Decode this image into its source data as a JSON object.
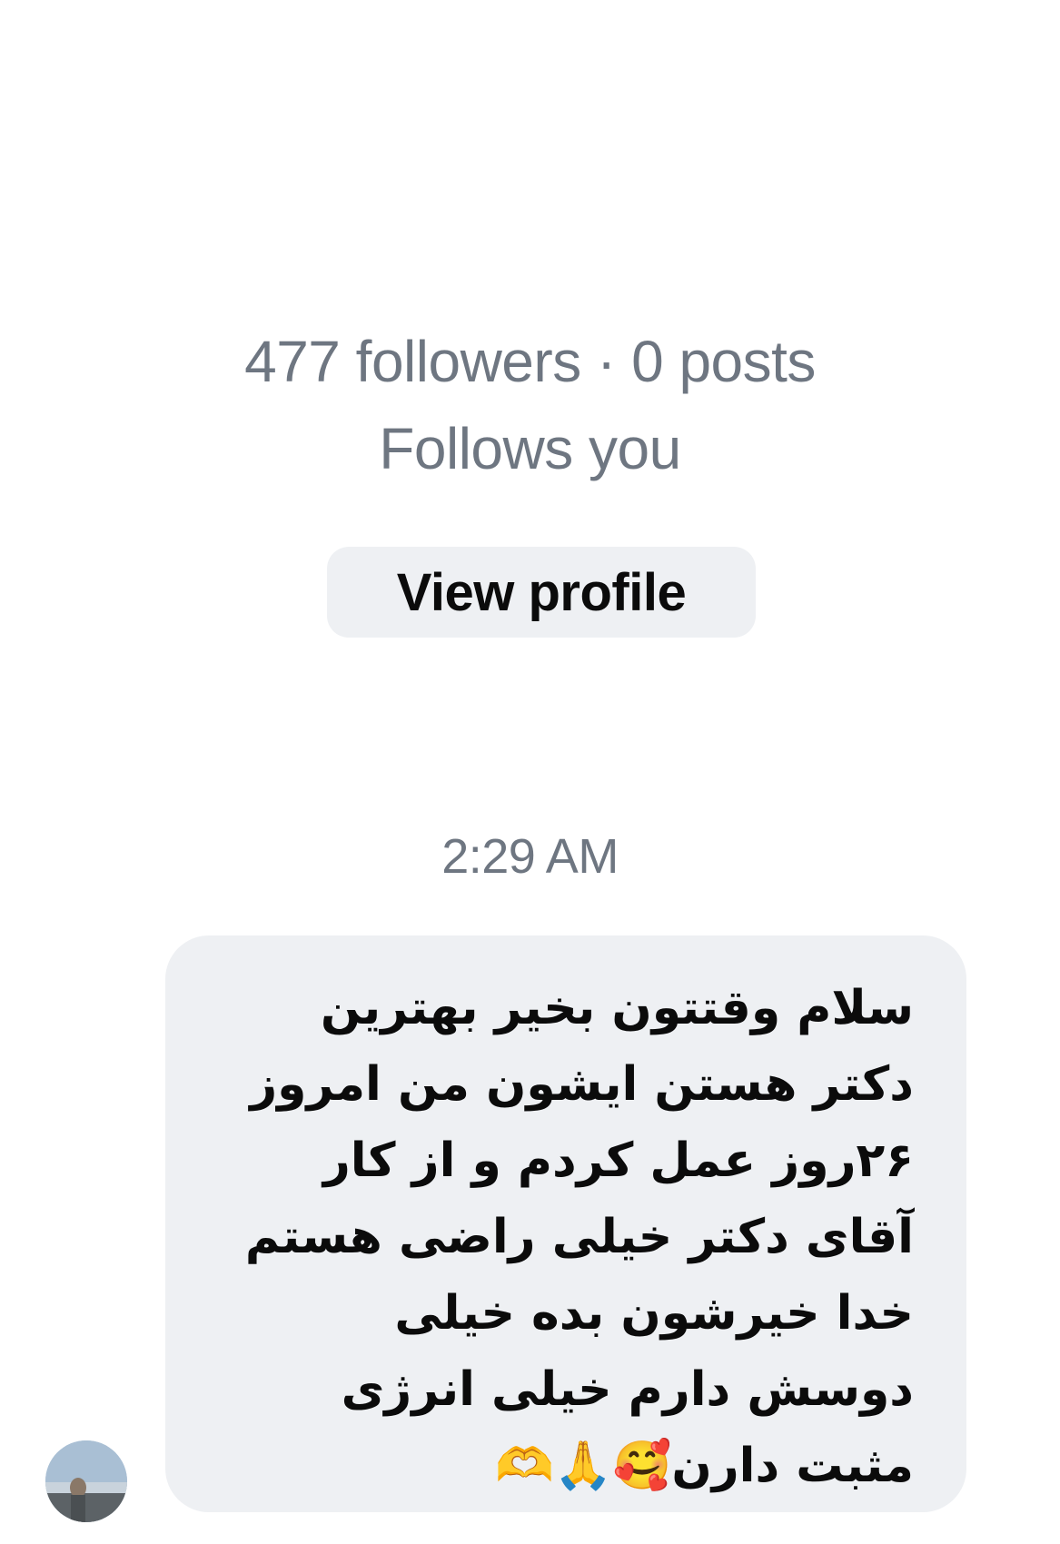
{
  "profile": {
    "stats": "477 followers · 0 posts",
    "relationship": "Follows you",
    "view_profile_label": "View profile"
  },
  "thread": {
    "timestamp": "2:29 AM",
    "message": {
      "lines": [
        "سلام وقتتون بخیر بهترین",
        "دکتر هستن ایشون من امروز",
        "۲۶روز عمل کردم و از کار",
        "آقای دکتر خیلی راضی هستم",
        "خدا خیرشون بده خیلی",
        "دوسش دارم خیلی انرژی",
        "مثبت دارن🥰🙏🫶"
      ]
    }
  }
}
